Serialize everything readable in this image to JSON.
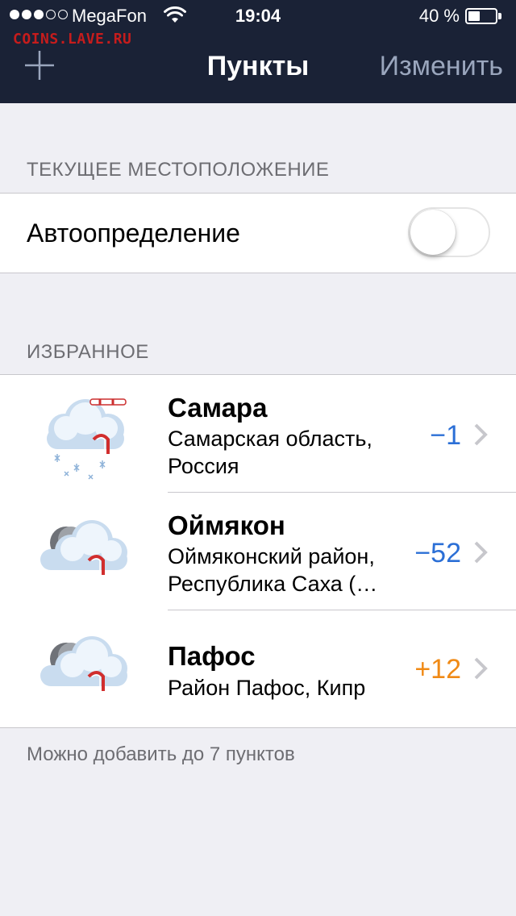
{
  "status_bar": {
    "signal_bars_filled": 3,
    "signal_bars_total": 5,
    "carrier": "MegaFon",
    "time": "19:04",
    "battery_percent": "40 %",
    "battery_level": 0.4
  },
  "watermark": "COINS.LAVE.RU",
  "nav": {
    "add_icon": "plus-icon",
    "title": "Пункты",
    "edit_label": "Изменить"
  },
  "current_location": {
    "header": "ТЕКУЩЕЕ МЕСТОПОЛОЖЕНИЕ",
    "auto_label": "Автоопределение",
    "auto_enabled": false
  },
  "favorites": {
    "header": "ИЗБРАННОЕ",
    "items": [
      {
        "city": "Самара",
        "region_line1": "Самарская область,",
        "region_line2": "Россия",
        "temp": "−1",
        "temp_color": "#2b6fd6",
        "icon": "cloud-snow-wind-icon"
      },
      {
        "city": "Оймякон",
        "region_line1": "Оймяконский район,",
        "region_line2": "Республика Саха (…",
        "temp": "−52",
        "temp_color": "#2b6fd6",
        "icon": "cloud-moon-icon"
      },
      {
        "city": "Пафос",
        "region_line1": "Район Пафос, Кипр",
        "region_line2": "",
        "temp": "+12",
        "temp_color": "#f08a16",
        "icon": "cloud-moon-icon"
      }
    ]
  },
  "footer_note": "Можно добавить до 7 пунктов",
  "colors": {
    "nav_background": "#1a2236",
    "page_background": "#efeff4",
    "edit_button": "#9aa6bd",
    "cold_temp": "#2b6fd6",
    "warm_temp": "#f08a16"
  }
}
